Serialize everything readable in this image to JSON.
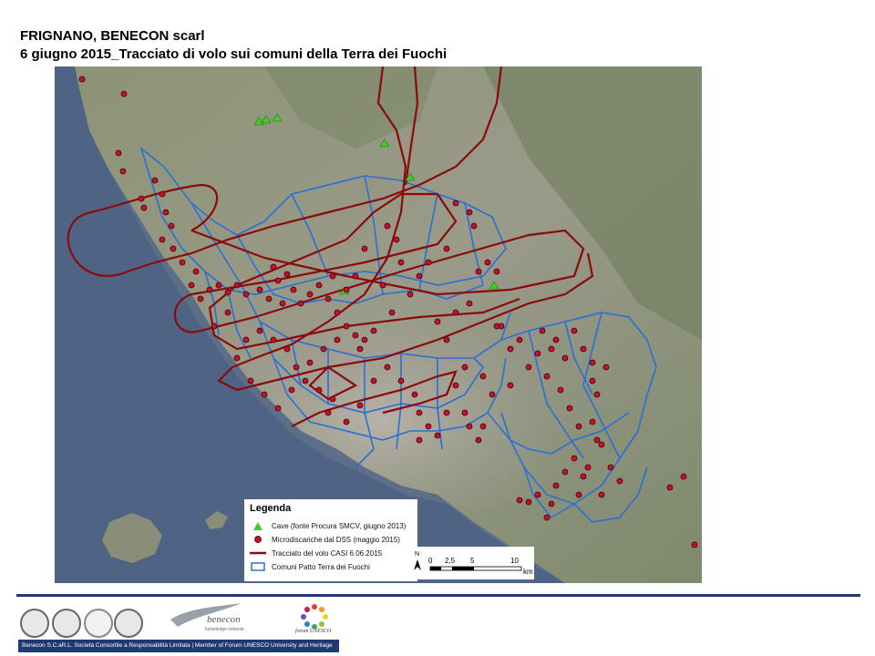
{
  "title_line1": "FRIGNANO, BENECON scarl",
  "title_line2": "6 giugno 2015_Tracciato di volo sui comuni della Terra dei Fuochi",
  "legend": {
    "title": "Legenda",
    "items": [
      {
        "label": "Cave (fonte Procura SMCV, giugno 2013)",
        "symbol": "green-triangle",
        "color": "#44cc22"
      },
      {
        "label": "Microdiscariche dal DSS (maggio 2015)",
        "symbol": "red-circle",
        "color": "#c8102e"
      },
      {
        "label": "Tracciato del volo CASI 6.06.2015",
        "symbol": "dark-red-line",
        "color": "#8b0a0a"
      },
      {
        "label": "Comuni Patto Terra dei Fuochi",
        "symbol": "blue-outline",
        "color": "#2a6fd6"
      }
    ]
  },
  "scale": {
    "north": "N",
    "labels": [
      "0",
      "2,5",
      "5",
      "10"
    ],
    "unit": "km"
  },
  "logos": {
    "benecon_name": "benecon",
    "benecon_sub": "knowledge network",
    "forum_name": "forum UNESCO"
  },
  "footer": "Benecon S.C.aR.L. Società Consortile a Responsabilità Limitata | Member of Forum UNESCO University and Heritage",
  "colors": {
    "route": "#8b0a0a",
    "boundary": "#2a6fd6",
    "dump": "#c8102e",
    "quarry": "#44cc22",
    "brand": "#1f3a73"
  }
}
